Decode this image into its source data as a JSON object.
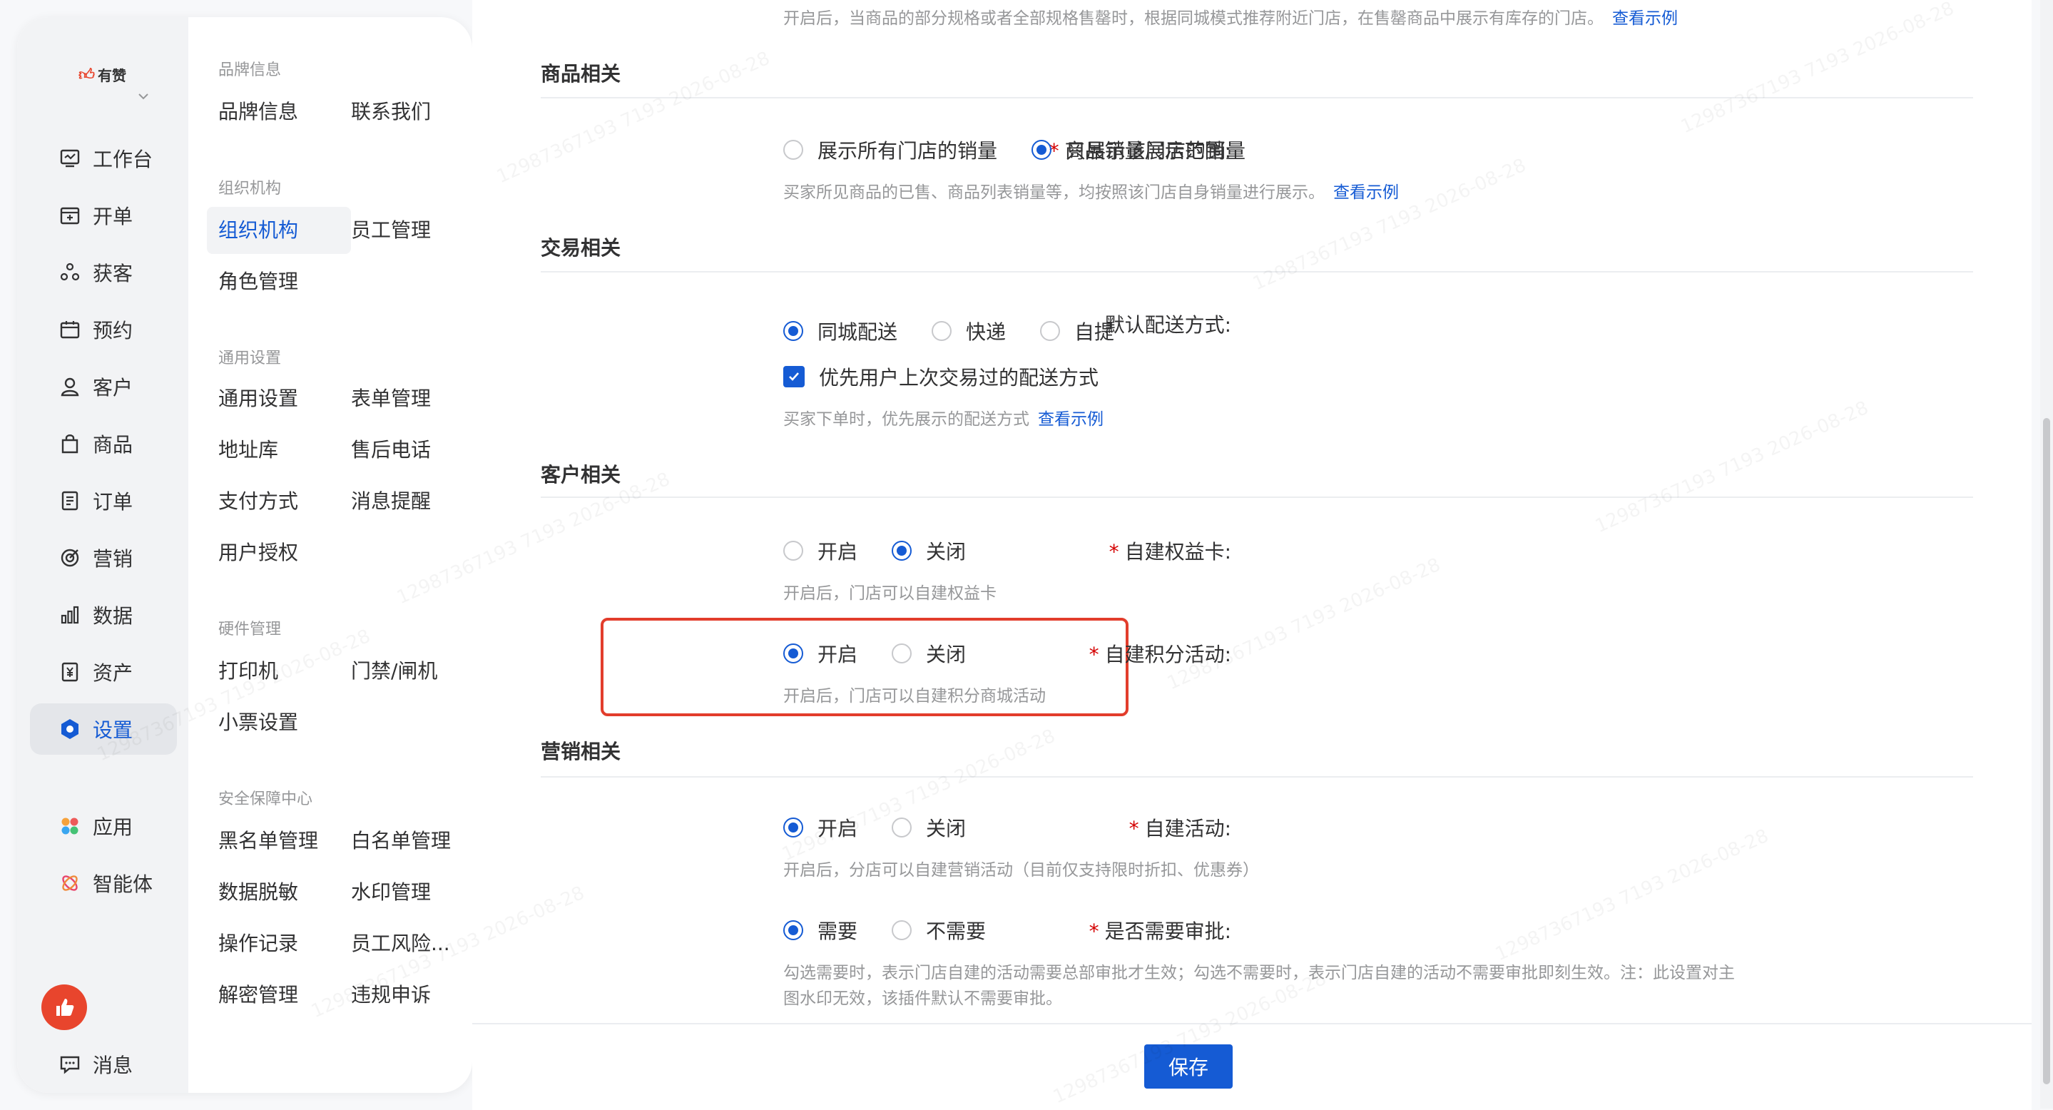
{
  "brand": {
    "logo_text": "有赞"
  },
  "primary_nav": [
    {
      "label": "工作台",
      "icon": "workbench-icon"
    },
    {
      "label": "开单",
      "icon": "order-create-icon"
    },
    {
      "label": "获客",
      "icon": "acquire-icon"
    },
    {
      "label": "预约",
      "icon": "calendar-icon"
    },
    {
      "label": "客户",
      "icon": "user-icon"
    },
    {
      "label": "商品",
      "icon": "bag-icon"
    },
    {
      "label": "订单",
      "icon": "document-icon"
    },
    {
      "label": "营销",
      "icon": "target-icon"
    },
    {
      "label": "数据",
      "icon": "bar-chart-icon"
    },
    {
      "label": "资产",
      "icon": "asset-icon"
    },
    {
      "label": "设置",
      "icon": "gear-icon",
      "active": true
    },
    {
      "label": "应用",
      "icon": "apps-icon"
    },
    {
      "label": "智能体",
      "icon": "agent-icon"
    },
    {
      "label": "消息",
      "icon": "message-icon"
    }
  ],
  "secondary_nav": {
    "groups": [
      {
        "title": "品牌信息",
        "items": [
          "品牌信息",
          "联系我们"
        ]
      },
      {
        "title": "组织机构",
        "items": [
          "组织机构",
          "员工管理",
          "角色管理"
        ],
        "active": "组织机构"
      },
      {
        "title": "通用设置",
        "items": [
          "通用设置",
          "表单管理",
          "地址库",
          "售后电话",
          "支付方式",
          "消息提醒",
          "用户授权"
        ]
      },
      {
        "title": "硬件管理",
        "items": [
          "打印机",
          "门禁/闸机",
          "小票设置"
        ]
      },
      {
        "title": "安全保障中心",
        "items": [
          "黑名单管理",
          "白名单管理",
          "数据脱敏",
          "水印管理",
          "操作记录",
          "员工风险...",
          "解密管理",
          "违规申诉"
        ]
      }
    ]
  },
  "content": {
    "top_help": "开启后，当商品的部分规格或者全部规格售罄时，根据同城模式推荐附近门店，在售罄商品中展示有库存的门店。",
    "top_help_link": "查看示例",
    "sections": {
      "goods": {
        "title": "商品相关",
        "sales_range": {
          "label": "商品销量展示范围:",
          "options": [
            "展示所有门店的销量",
            "只展示该门店的销量"
          ],
          "selected": 1,
          "help": "买家所见商品的已售、商品列表销量等，均按照该门店自身销量进行展示。",
          "help_link": "查看示例"
        }
      },
      "trade": {
        "title": "交易相关",
        "delivery": {
          "label": "默认配送方式:",
          "options": [
            "同城配送",
            "快递",
            "自提"
          ],
          "selected": 0,
          "checkbox_label": "优先用户上次交易过的配送方式",
          "checkbox_checked": true,
          "help": "买家下单时，优先展示的配送方式",
          "help_link": "查看示例"
        }
      },
      "customer": {
        "title": "客户相关",
        "benefit_card": {
          "label": "自建权益卡:",
          "options": [
            "开启",
            "关闭"
          ],
          "selected": 1,
          "help": "开启后，门店可以自建权益卡"
        },
        "points_activity": {
          "label": "自建积分活动:",
          "options": [
            "开启",
            "关闭"
          ],
          "selected": 0,
          "help": "开启后，门店可以自建积分商城活动"
        }
      },
      "marketing": {
        "title": "营销相关",
        "activity": {
          "label": "自建活动:",
          "options": [
            "开启",
            "关闭"
          ],
          "selected": 0,
          "help": "开启后，分店可以自建营销活动（目前仅支持限时折扣、优惠券）"
        },
        "approval": {
          "label": "是否需要审批:",
          "options": [
            "需要",
            "不需要"
          ],
          "selected": 0,
          "help_line1": "勾选需要时，表示门店自建的活动需要总部审批才生效；勾选不需要时，表示门店自建的活动不需要审批即刻生效。注：此设置对主",
          "help_line2": "图水印无效，该插件默认不需要审批。"
        }
      }
    }
  },
  "footer": {
    "save_label": "保存"
  },
  "watermark": {
    "text": "12987367193 7193 2026-08-28"
  },
  "colors": {
    "primary": "#155bd4",
    "required": "#d40000",
    "highlight": "#e23d2c",
    "brand": "#e8452d"
  }
}
